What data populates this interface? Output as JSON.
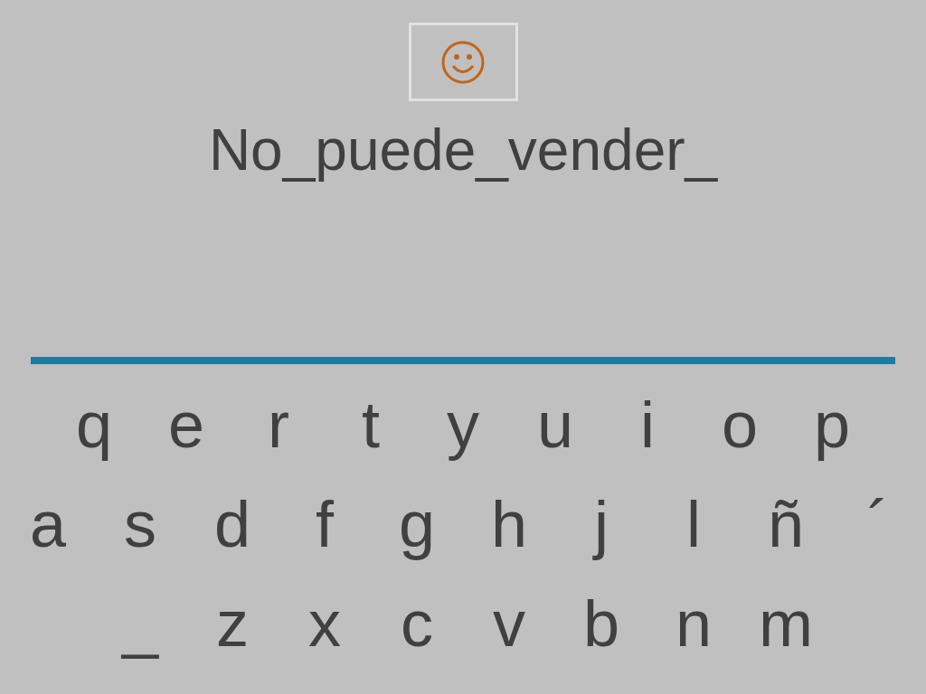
{
  "answer": "No_puede_vender_",
  "keyboard": {
    "rows": [
      [
        "q",
        "e",
        "r",
        "t",
        "y",
        "u",
        "i",
        "o",
        "p"
      ],
      [
        "a",
        "s",
        "d",
        "f",
        "g",
        "h",
        "j",
        "l",
        "ñ",
        "´"
      ],
      [
        "_",
        "z",
        "x",
        "c",
        "v",
        "b",
        "n",
        "m"
      ]
    ]
  }
}
